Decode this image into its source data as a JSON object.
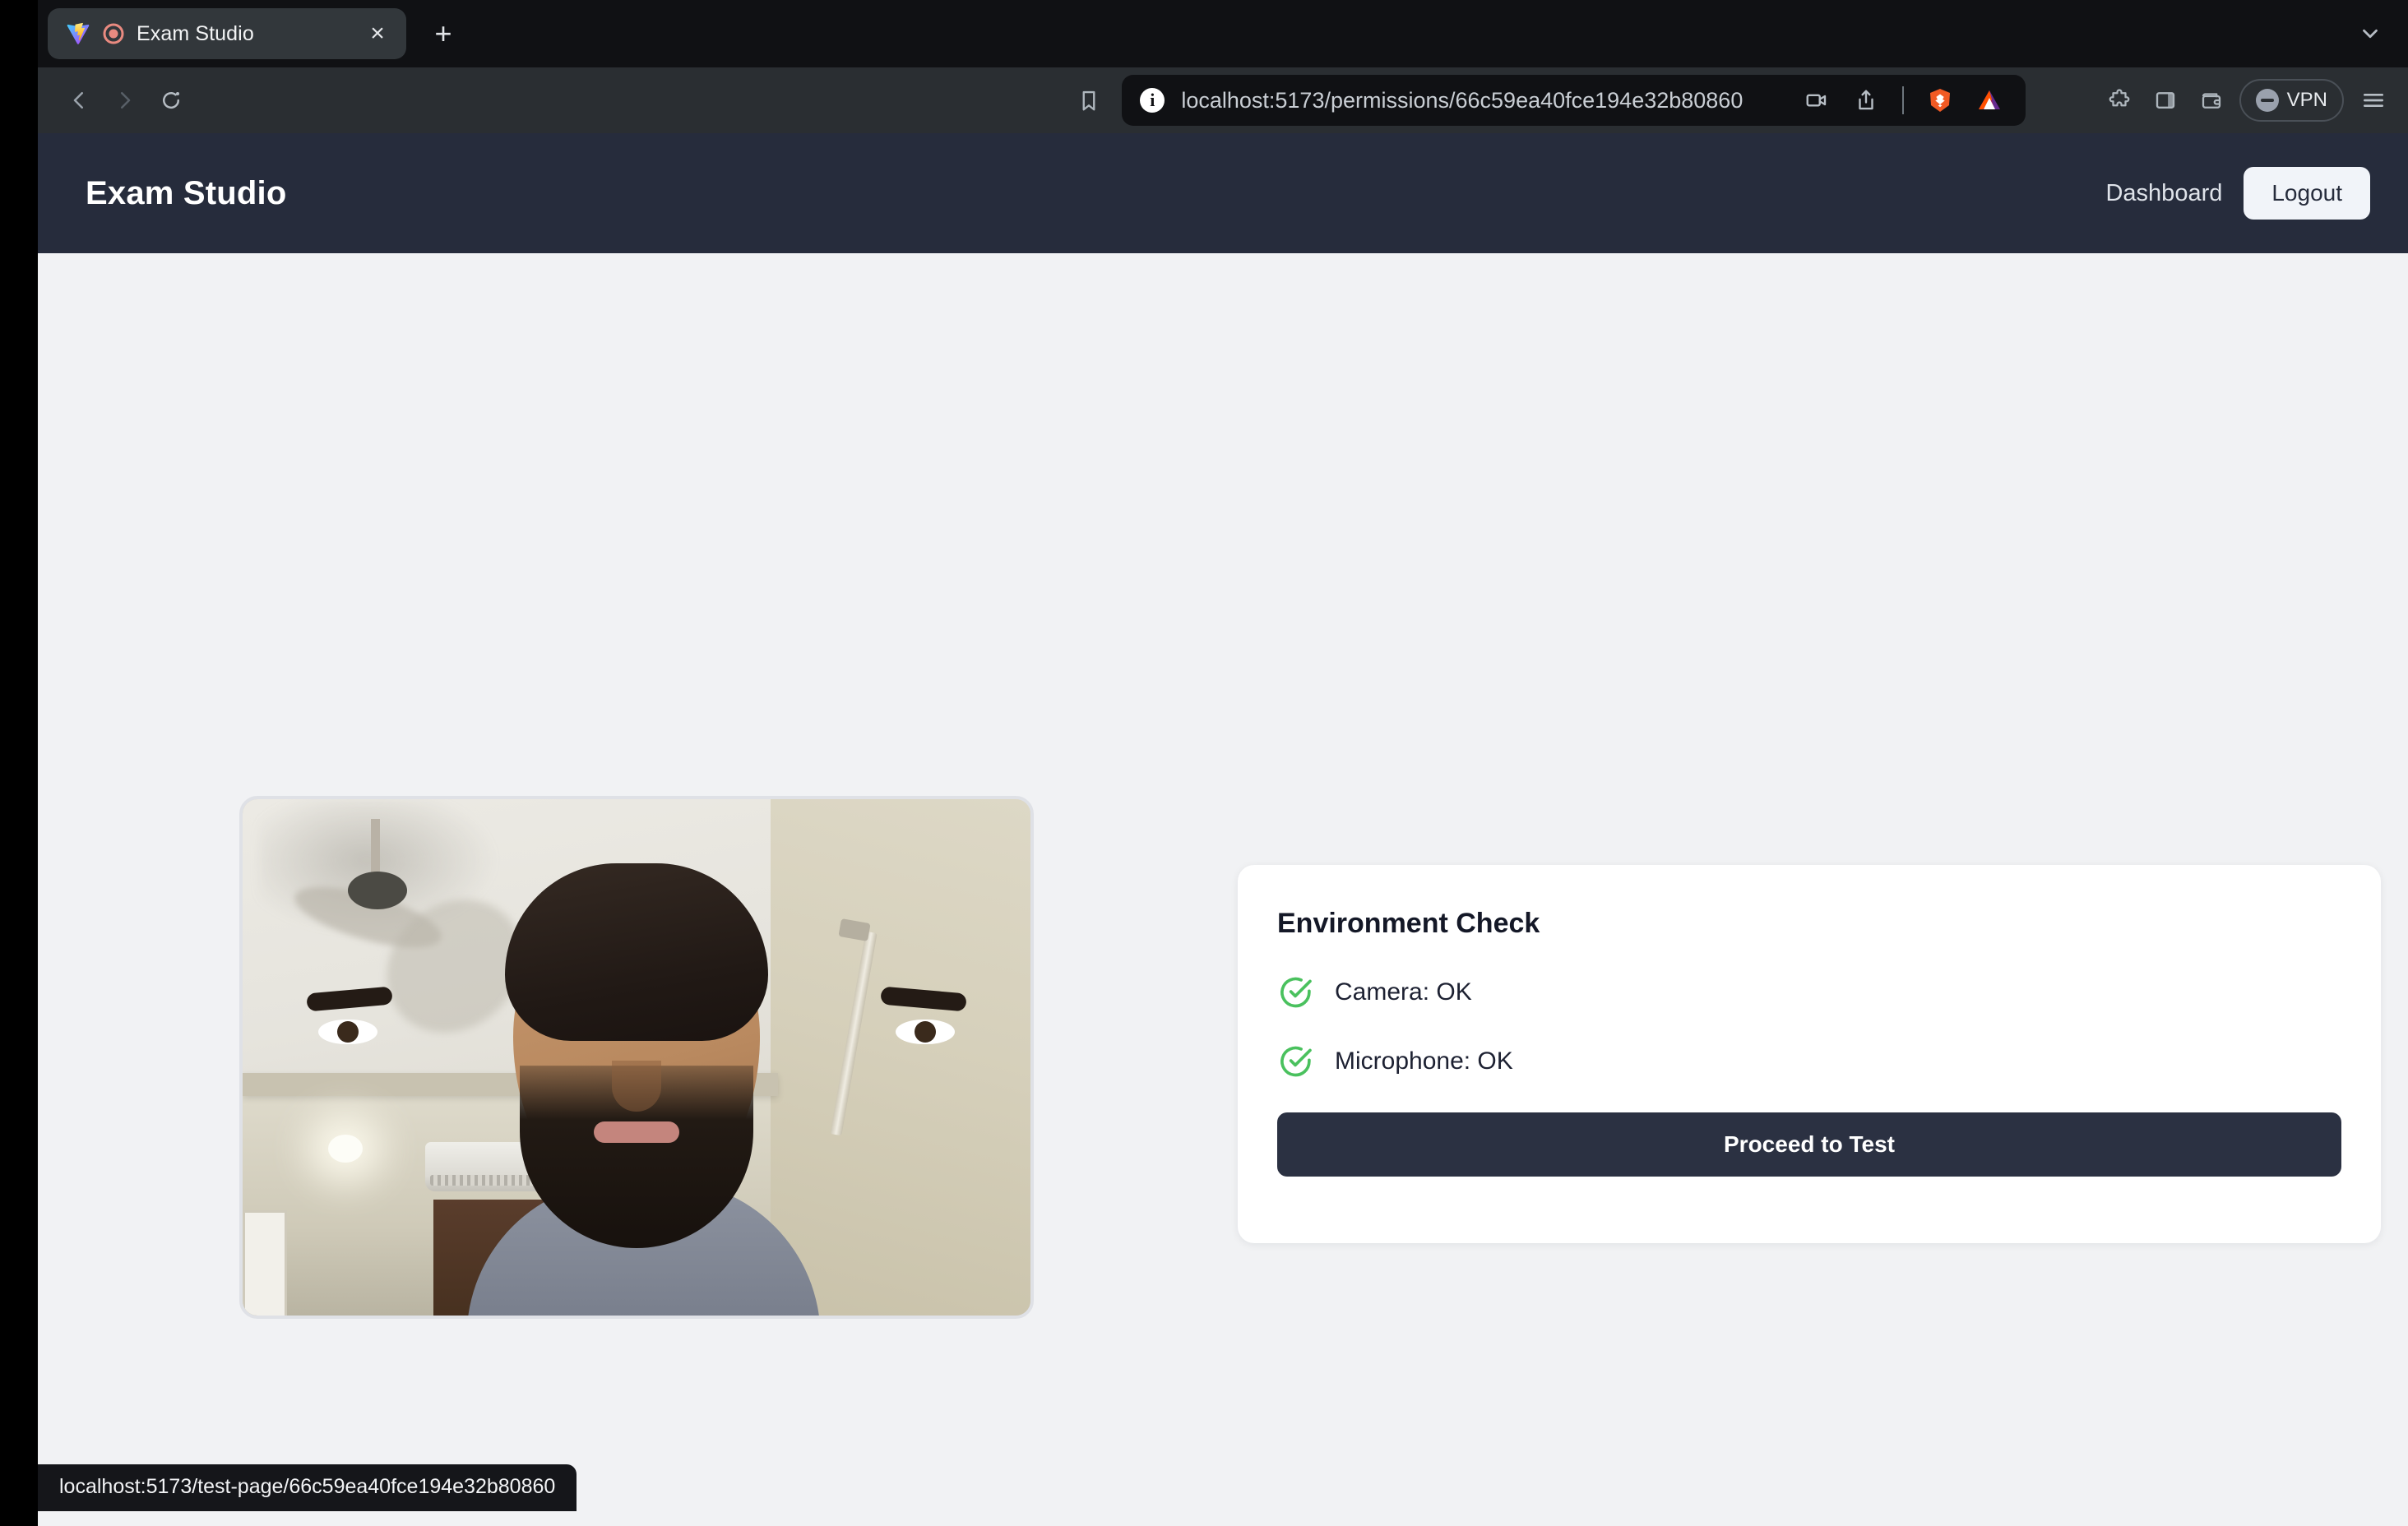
{
  "browser": {
    "tab": {
      "title": "Exam Studio",
      "favicon": "vite-logo-icon",
      "recording_indicator": "camera-recording-icon",
      "close_label": "×"
    },
    "new_tab_label": "+",
    "collapse_icon": "chevron-down-icon",
    "toolbar": {
      "back_icon": "back-arrow-icon",
      "forward_icon": "forward-arrow-icon",
      "reload_icon": "reload-icon",
      "bookmark_icon": "bookmark-icon",
      "site_info_label": "i",
      "url": "localhost:5173/permissions/66c59ea40fce194e32b80860",
      "camera_icon": "video-camera-icon",
      "share_icon": "share-upload-icon",
      "shields_icon": "brave-lion-icon",
      "rewards_icon": "brave-bat-triangle-icon",
      "extensions_icon": "puzzle-piece-icon",
      "sidebar_icon": "sidepanel-icon",
      "wallet_icon": "wallet-icon",
      "vpn_label": "VPN",
      "menu_icon": "hamburger-menu-icon"
    },
    "status_bubble": "localhost:5173/test-page/66c59ea40fce194e32b80860"
  },
  "app": {
    "title": "Exam Studio",
    "nav": {
      "dashboard_label": "Dashboard",
      "logout_label": "Logout"
    },
    "video_preview": {
      "name": "webcam-preview"
    },
    "env_card": {
      "title": "Environment Check",
      "checks": [
        {
          "icon": "check-circle-icon",
          "label": "Camera: OK"
        },
        {
          "icon": "check-circle-icon",
          "label": "Microphone: OK"
        }
      ],
      "proceed_label": "Proceed to Test"
    }
  },
  "colors": {
    "header_bg": "#262c3c",
    "page_bg": "#f1f2f4",
    "accent_button": "#2b3142",
    "success": "#4ac15e",
    "browser_chrome": "#2a2e32"
  }
}
